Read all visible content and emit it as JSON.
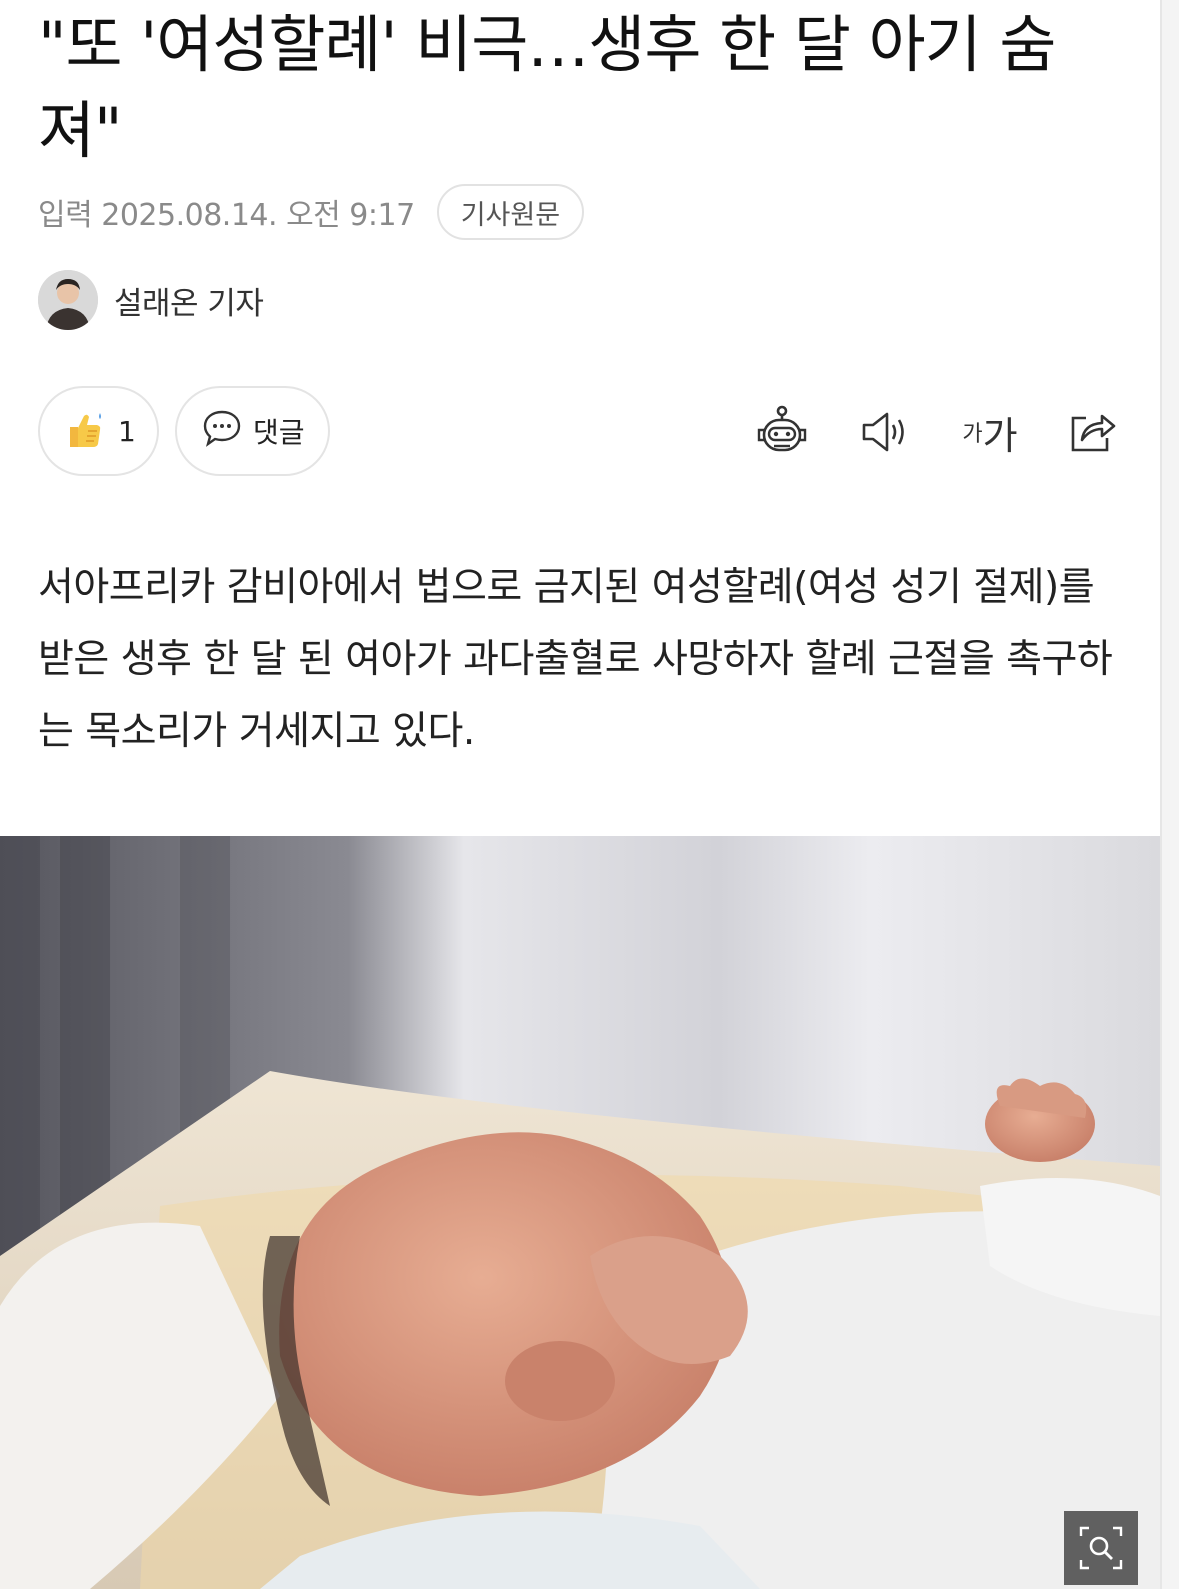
{
  "article": {
    "title": "\"또 '여성할례' 비극…생후 한 달 아기 숨져\"",
    "meta": {
      "published": "입력 2025.08.14. 오전 9:17",
      "source_button": "기사원문"
    },
    "author": {
      "name": "설래온 기자"
    },
    "actions": {
      "like_count": "1",
      "comment_label": "댓글",
      "tools": [
        "robot-summary-icon",
        "speaker-icon",
        "font-size-icon",
        "share-icon"
      ],
      "font_small": "가",
      "font_large": "가"
    },
    "lead": "서아프리카 감비아에서 법으로 금지된 여성할례(여성 성기 절제)를 받은 생후 한 달 된 여아가 과다출혈로 사망하자 할례 근절을 촉구하는 목소리가 거세지고 있다.",
    "photo": {
      "subject": "newborn-baby-photo"
    }
  },
  "colors": {
    "text": "#1a1a1a",
    "meta": "#8a8a8a",
    "border": "#e2e2e2",
    "like": "#f7c948"
  }
}
